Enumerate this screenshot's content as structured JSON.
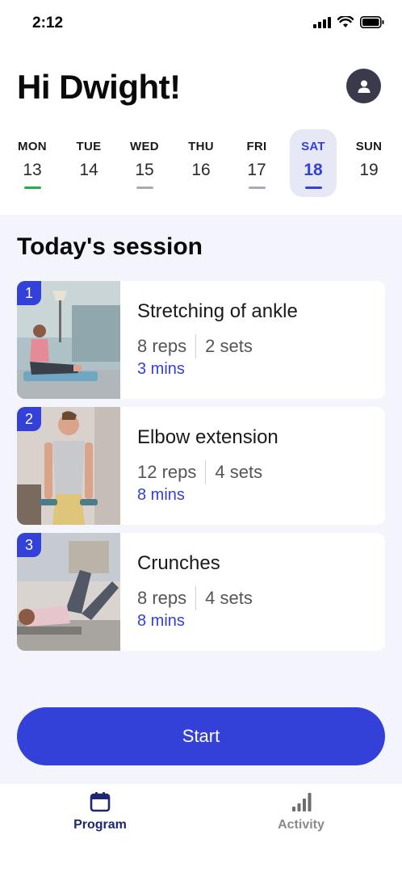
{
  "status_bar": {
    "time": "2:12"
  },
  "header": {
    "greeting": "Hi Dwight!"
  },
  "week": {
    "days": [
      {
        "name": "MON",
        "num": "13",
        "indicator": "complete"
      },
      {
        "name": "TUE",
        "num": "14",
        "indicator": "none"
      },
      {
        "name": "WED",
        "num": "15",
        "indicator": "scheduled"
      },
      {
        "name": "THU",
        "num": "16",
        "indicator": "none"
      },
      {
        "name": "FRI",
        "num": "17",
        "indicator": "scheduled"
      },
      {
        "name": "SAT",
        "num": "18",
        "indicator": "selected"
      },
      {
        "name": "SUN",
        "num": "19",
        "indicator": "none"
      }
    ],
    "colors": {
      "complete": "#22b04a",
      "scheduled": "#a9a9b8",
      "selected": "#3341d9"
    }
  },
  "session": {
    "title": "Today's session",
    "exercises": [
      {
        "index": "1",
        "title": "Stretching of ankle",
        "reps": "8 reps",
        "sets": "2 sets",
        "duration": "3 mins"
      },
      {
        "index": "2",
        "title": "Elbow extension",
        "reps": "12 reps",
        "sets": "4 sets",
        "duration": "8 mins"
      },
      {
        "index": "3",
        "title": "Crunches",
        "reps": "8 reps",
        "sets": "4 sets",
        "duration": "8 mins"
      }
    ]
  },
  "start_button": {
    "label": "Start"
  },
  "tabbar": {
    "tabs": [
      {
        "label": "Program",
        "icon": "calendar-icon",
        "active": true
      },
      {
        "label": "Activity",
        "icon": "bar-chart-icon",
        "active": false
      }
    ]
  },
  "theme": {
    "accent": "#3341d9",
    "background": "#f4f4fc"
  }
}
